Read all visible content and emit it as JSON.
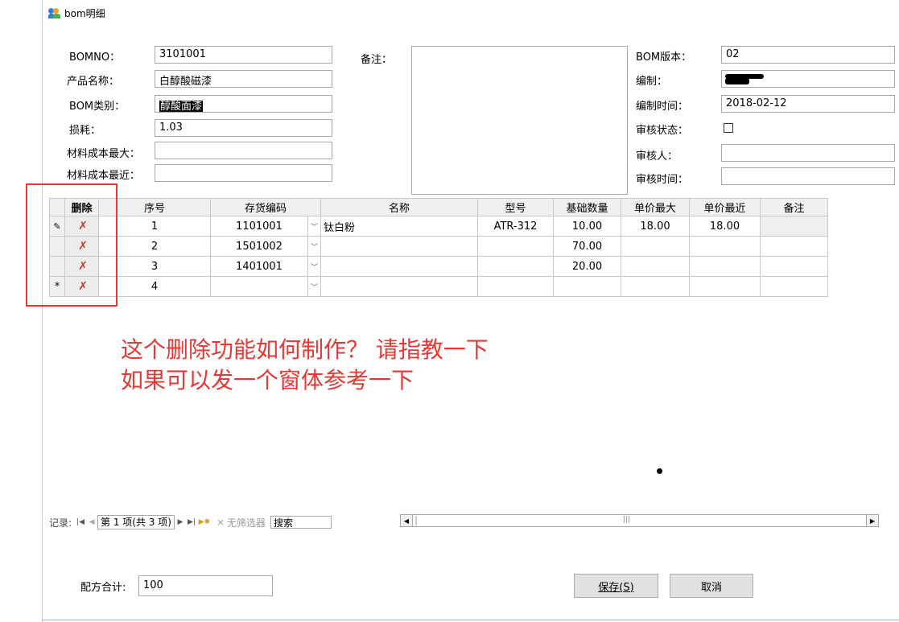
{
  "window": {
    "title": "bom明细"
  },
  "form": {
    "bomno": {
      "label": "BOMNO：",
      "value": "3101001"
    },
    "product_name": {
      "label": "产品名称：",
      "value": "白醇酸磁漆"
    },
    "bom_category": {
      "label": "BOM类别：",
      "value": "醇酸面漆"
    },
    "loss": {
      "label": "损耗：",
      "value": "1.03"
    },
    "max_material_cost": {
      "label": "材料成本最大：",
      "value": ""
    },
    "recent_material_cost": {
      "label": "材料成本最近：",
      "value": ""
    },
    "remarks": {
      "label": "备注：",
      "value": ""
    },
    "bom_version": {
      "label": "BOM版本：",
      "value": "02"
    },
    "author": {
      "label": "编制：",
      "value": ""
    },
    "author_time": {
      "label": "编制时间：",
      "value": "2018-02-12"
    },
    "review_status": {
      "label": "审核状态：",
      "checked": false
    },
    "reviewer": {
      "label": "审核人：",
      "value": ""
    },
    "review_time": {
      "label": "审核时间：",
      "value": ""
    }
  },
  "grid": {
    "columns": [
      "删除",
      "序号",
      "存货编码",
      "名称",
      "型号",
      "基础数量",
      "单价最大",
      "单价最近",
      "备注"
    ],
    "rows": [
      {
        "selector": "✎",
        "seq": "1",
        "code": "1101001",
        "name": "钛白粉",
        "model": "ATR-312",
        "qty": "10.00",
        "price_max": "18.00",
        "price_recent": "18.00",
        "remark": ""
      },
      {
        "selector": "",
        "seq": "2",
        "code": "1501002",
        "name": "",
        "model": "",
        "qty": "70.00",
        "price_max": "",
        "price_recent": "",
        "remark": ""
      },
      {
        "selector": "",
        "seq": "3",
        "code": "1401001",
        "name": "",
        "model": "",
        "qty": "20.00",
        "price_max": "",
        "price_recent": "",
        "remark": ""
      },
      {
        "selector": "*",
        "seq": "4",
        "code": "",
        "name": "",
        "model": "",
        "qty": "",
        "price_max": "",
        "price_recent": "",
        "remark": ""
      }
    ]
  },
  "annotation": {
    "line1": "这个删除功能如何制作？ 请指教一下",
    "line2": "如果可以发一个窗体参考一下",
    "color": "#e53935"
  },
  "navigator": {
    "record_label": "记录:",
    "position": "第 1 项(共 3 项)",
    "no_filter": "无筛选器",
    "search": "搜索"
  },
  "footer": {
    "total_label": "配方合计:",
    "total_value": "100",
    "save_label": "保存(S)",
    "cancel_label": "取消"
  }
}
